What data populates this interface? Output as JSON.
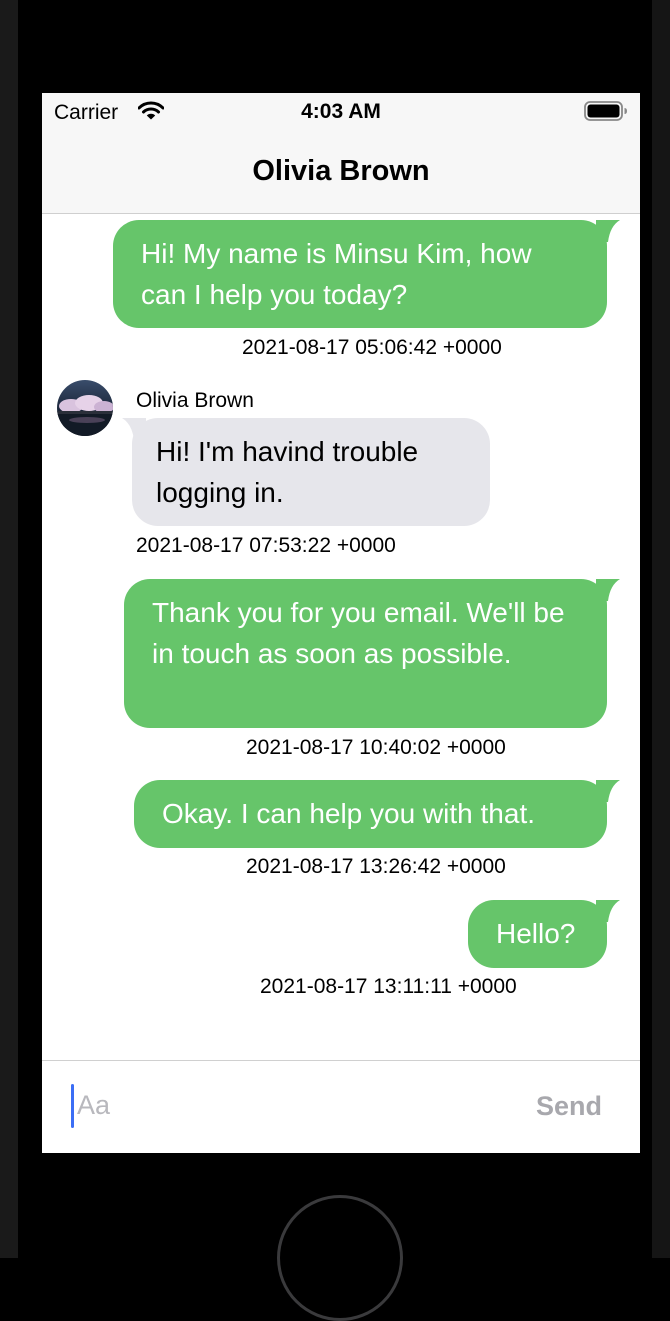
{
  "status_bar": {
    "carrier": "Carrier",
    "time": "4:03 AM"
  },
  "nav": {
    "title": "Olivia Brown"
  },
  "messages": [
    {
      "direction": "outgoing",
      "text": "Hi! My name is Minsu Kim, how can I help you today?",
      "timestamp": "2021-08-17 05:06:42 +0000"
    },
    {
      "direction": "incoming",
      "sender": "Olivia Brown",
      "text": "Hi! I'm havind trouble logging in.",
      "timestamp": "2021-08-17 07:53:22 +0000"
    },
    {
      "direction": "outgoing",
      "text": "Thank you for you email. We'll be in touch as soon as possible.",
      "timestamp": "2021-08-17 10:40:02 +0000"
    },
    {
      "direction": "outgoing",
      "text": "Okay. I can help you with that.",
      "timestamp": "2021-08-17 13:26:42 +0000"
    },
    {
      "direction": "outgoing",
      "text": "Hello?",
      "timestamp": "2021-08-17 13:11:11 +0000"
    }
  ],
  "input_bar": {
    "placeholder": "Aa",
    "value": "",
    "send_label": "Send"
  },
  "colors": {
    "outgoing_bubble": "#66c56a",
    "incoming_bubble": "#e6e6eb",
    "send_disabled": "#a8a8ad",
    "caret": "#3b6ef5"
  },
  "icons": [
    "wifi-icon",
    "battery-icon",
    "avatar",
    "home-button"
  ]
}
